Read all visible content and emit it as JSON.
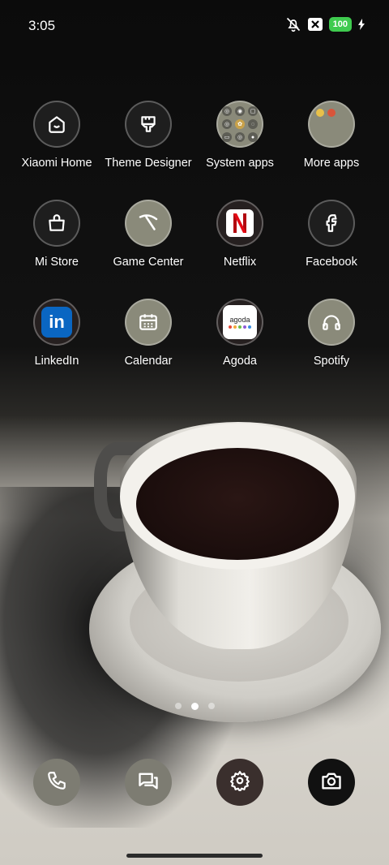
{
  "statusbar": {
    "time": "3:05",
    "battery": "100"
  },
  "apps": [
    {
      "label": "Xiaomi Home",
      "icon": "xiaomi-home-icon"
    },
    {
      "label": "Theme Designer",
      "icon": "theme-designer-icon"
    },
    {
      "label": "System apps",
      "icon": "system-apps-folder-icon"
    },
    {
      "label": "More apps",
      "icon": "more-apps-folder-icon"
    },
    {
      "label": "Mi Store",
      "icon": "mi-store-icon"
    },
    {
      "label": "Game Center",
      "icon": "game-center-icon"
    },
    {
      "label": "Netflix",
      "icon": "netflix-icon"
    },
    {
      "label": "Facebook",
      "icon": "facebook-icon"
    },
    {
      "label": "LinkedIn",
      "icon": "linkedin-icon"
    },
    {
      "label": "Calendar",
      "icon": "calendar-icon"
    },
    {
      "label": "Agoda",
      "icon": "agoda-icon"
    },
    {
      "label": "Spotify",
      "icon": "spotify-icon"
    }
  ],
  "agoda_wordmark": "agoda",
  "page_indicator": {
    "pages": 3,
    "active": 2
  },
  "dock": [
    "phone-icon",
    "messages-icon",
    "settings-icon",
    "camera-icon"
  ],
  "colors": {
    "battery": "#3fcb4f",
    "linkedin": "#0a66c2",
    "netflix": "#e50914"
  }
}
